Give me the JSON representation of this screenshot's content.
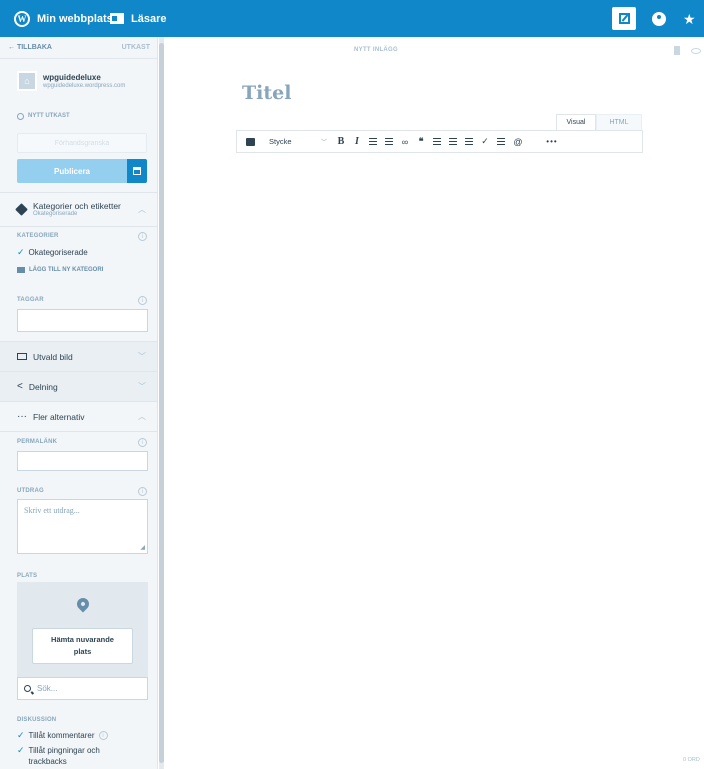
{
  "topbar": {
    "site_label": "Min webbplats",
    "reader_label": "Läsare",
    "wp_logo_glyph": "W",
    "write_icon": "edit-icon",
    "avatar_icon": "user-avatar",
    "notif_icon": "notification-icon"
  },
  "sidebar": {
    "back_label": "← TILLBAKA",
    "draft_status": "UTKAST",
    "site_name": "wpguidedeluxe",
    "site_url": "wpguidedeluxe.wordpress.com",
    "new_draft_label": "NYTT UTKAST",
    "preview_label": "Förhandsgranska",
    "publish_label": "Publicera",
    "categories": {
      "title": "Kategorier och etiketter",
      "subtitle": "Okategoriserade",
      "label": "KATEGORIER",
      "items": [
        {
          "label": "Okategoriserade",
          "checked": true
        }
      ],
      "add_label": "LÄGG TILL NY KATEGORI"
    },
    "tags_label": "TAGGAR",
    "featured_label": "Utvald bild",
    "sharing_label": "Delning",
    "more_label": "Fler alternativ",
    "permalink_label": "PERMALÄNK",
    "excerpt_label": "UTDRAG",
    "excerpt_placeholder": "Skriv ett utdrag...",
    "location_label": "PLATS",
    "location_button": "Hämta nuvarande plats",
    "location_search": "Sök...",
    "discussion_label": "DISKUSSION",
    "discussion_items": [
      {
        "label": "Tillåt kommentarer",
        "checked": true
      },
      {
        "label": "Tillåt pingningar och trackbacks",
        "checked": true
      }
    ]
  },
  "editor": {
    "post_type_label": "NYTT INLÄGG",
    "title_placeholder": "Titel",
    "tabs": [
      "Visual",
      "HTML"
    ],
    "active_tab": "Visual",
    "format_select": "Stycke",
    "toolbar_glyphs": {
      "bold": "B",
      "italic": "I",
      "link": "🔗",
      "quote": "❝",
      "more": "•••",
      "contact": "@"
    },
    "word_count": "0 ORD"
  },
  "colors": {
    "accent": "#0f87c9",
    "publish_disabled": "#94cff0",
    "text": "#2e4453",
    "muted": "#87a6bc"
  }
}
